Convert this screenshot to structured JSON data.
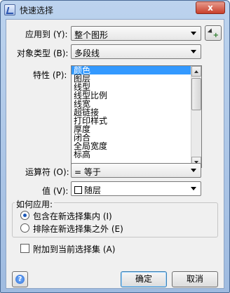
{
  "title": "快速选择",
  "close_label": "x",
  "apply_to": {
    "label": "应用到 (Y):",
    "value": "整个图形"
  },
  "object_type": {
    "label": "对象类型 (B):",
    "value": "多段线"
  },
  "properties": {
    "label": "特性 (P):",
    "items": [
      "颜色",
      "图层",
      "线型",
      "线型比例",
      "线宽",
      "超链接",
      "打印样式",
      "厚度",
      "闭合",
      "全局宽度",
      "标高"
    ],
    "selected_index": 0
  },
  "operator": {
    "label": "运算符 (O):",
    "value": "= 等于"
  },
  "value": {
    "label": "值 (V):",
    "value": "随层"
  },
  "how_to_apply": {
    "label": "如何应用:",
    "options": [
      "包含在新选择集内 (I)",
      "排除在新选择集之外 (E)"
    ],
    "selected_index": 0
  },
  "append": {
    "label": "附加到当前选择集 (A)",
    "checked": false
  },
  "buttons": {
    "help": "?",
    "ok": "确定",
    "cancel": "取消"
  }
}
